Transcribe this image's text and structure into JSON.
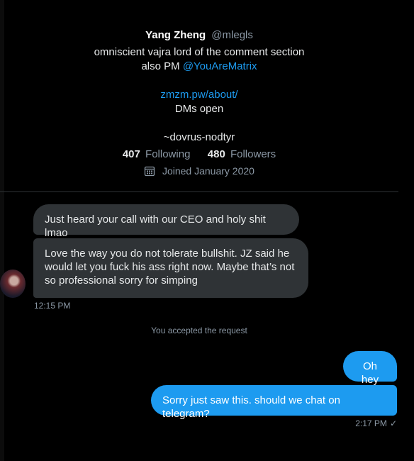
{
  "profile": {
    "display_name": "Yang Zheng",
    "handle": "@mlegls",
    "bio_line1": "omniscient vajra lord of the comment section",
    "bio_line2_prefix": "also PM",
    "bio_mention": "@YouAreMatrix",
    "website": "zmzm.pw/about/",
    "dms_status": "DMs open",
    "tagline": "~dovrus-nodtyr",
    "following_count": "407",
    "following_label": "Following",
    "followers_count": "480",
    "followers_label": "Followers",
    "joined": "Joined January 2020",
    "calendar_icon": "calendar-icon"
  },
  "messages": [
    {
      "direction": "incoming",
      "text": "Just heard your call with our CEO and holy shit lmao"
    },
    {
      "direction": "incoming",
      "text": "Love the way you do not tolerate bullshit. JZ said he would let you fuck his ass right now. Maybe that’s not so professional sorry for simping"
    },
    {
      "direction": "outgoing",
      "text": "Oh hey"
    },
    {
      "direction": "outgoing",
      "text": "Sorry just saw this. should we chat on telegram?"
    }
  ],
  "incoming_timestamp": "12:15 PM",
  "system_message": "You accepted the request",
  "outgoing_timestamp": "2:17 PM",
  "read_check_icon": "check-icon",
  "colors": {
    "background": "#000000",
    "incoming_bubble": "#2f3336",
    "outgoing_bubble": "#1d9bf0",
    "accent": "#1d9bf0",
    "muted_text": "#8b98a5"
  }
}
